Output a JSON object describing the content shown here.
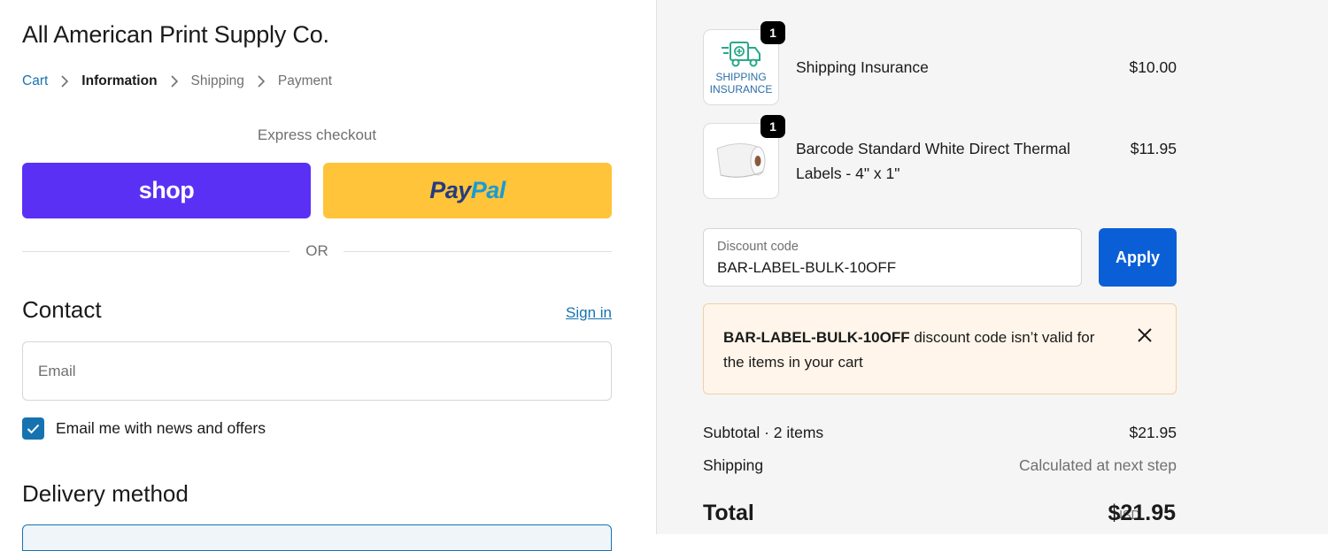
{
  "store": {
    "title": "All American Print Supply Co."
  },
  "breadcrumb": [
    {
      "label": "Cart"
    },
    {
      "label": "Information"
    },
    {
      "label": "Shipping"
    },
    {
      "label": "Payment"
    }
  ],
  "express": {
    "label": "Express checkout",
    "shop_label": "shop",
    "paypal_label_a": "Pay",
    "paypal_label_b": "Pal"
  },
  "divider": {
    "or_label": "OR"
  },
  "contact": {
    "heading": "Contact",
    "signin_label": "Sign in",
    "email_placeholder": "Email",
    "email_value": "",
    "newsletter_label": "Email me with news and offers",
    "newsletter_checked": true
  },
  "delivery": {
    "heading": "Delivery method"
  },
  "order": {
    "items": [
      {
        "name": "Shipping Insurance",
        "price": "$10.00",
        "quantity": "1",
        "thumb_text_1": "SHIPPING",
        "thumb_text_2": "INSURANCE"
      },
      {
        "name": "Barcode Standard White Direct Thermal Labels - 4\" x 1\"",
        "price": "$11.95",
        "quantity": "1"
      }
    ],
    "discount": {
      "label": "Discount code",
      "value": "BAR-LABEL-BULK-10OFF",
      "apply_label": "Apply"
    },
    "alert": {
      "code": "BAR-LABEL-BULK-10OFF",
      "message": " discount code isn’t valid for the items in your cart"
    },
    "subtotal": {
      "label": "Subtotal · 2 items",
      "value": "$21.95"
    },
    "shipping": {
      "label": "Shipping",
      "value": "Calculated at next step"
    },
    "total": {
      "label": "Total",
      "currency": "USD",
      "value": "$21.95"
    }
  },
  "colors": {
    "shop_purple": "#5a31f4",
    "paypal_yellow": "#ffc439",
    "link_blue": "#1773b0",
    "apply_blue": "#0b5fd6",
    "alert_bg": "#fff5ea"
  },
  "icons": [
    "chevron-right-icon",
    "checkmark-icon",
    "close-icon",
    "truck-icon",
    "label-roll-icon"
  ]
}
